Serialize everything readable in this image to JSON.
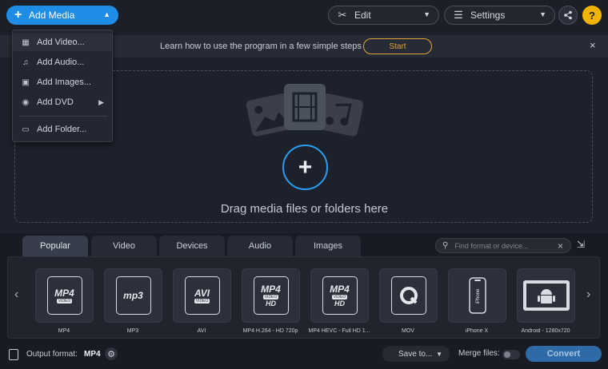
{
  "toolbar": {
    "add_media_label": "Add Media",
    "edit_label": "Edit",
    "settings_label": "Settings",
    "help_label": "?"
  },
  "tutorial": {
    "text": "Learn how to use the program in a few simple steps",
    "start_label": "Start",
    "close_label": "×"
  },
  "dropzone": {
    "text": "Drag media files or folders here"
  },
  "add_menu": {
    "items": [
      {
        "label": "Add Video...",
        "icon": "film-icon"
      },
      {
        "label": "Add Audio...",
        "icon": "music-note-icon"
      },
      {
        "label": "Add Images...",
        "icon": "image-icon"
      },
      {
        "label": "Add DVD",
        "icon": "disc-icon",
        "has_submenu": true
      },
      {
        "label": "Add Folder...",
        "icon": "folder-icon"
      }
    ]
  },
  "tabs": [
    "Popular",
    "Video",
    "Devices",
    "Audio",
    "Images"
  ],
  "active_tab": "Popular",
  "search": {
    "placeholder": "Find format or device...",
    "clear_label": "×"
  },
  "formats": [
    {
      "label": "MP4",
      "badge": "MP4",
      "sub": "VIDEO"
    },
    {
      "label": "MP3",
      "badge": "mp3",
      "sub": ""
    },
    {
      "label": "AVI",
      "badge": "AVI",
      "sub": "VIDEO"
    },
    {
      "label": "MP4 H.264 - HD 720p",
      "badge": "MP4",
      "sub": "VIDEO",
      "extra": "HD"
    },
    {
      "label": "MP4 HEVC - Full HD 1...",
      "badge": "MP4",
      "sub": "VIDEO",
      "extra": "HD"
    },
    {
      "label": "MOV",
      "badge": "Q",
      "sub": ""
    },
    {
      "label": "iPhone X",
      "badge": "iPhone",
      "sub": ""
    },
    {
      "label": "Android - 1280x720",
      "badge": "android",
      "sub": ""
    }
  ],
  "bottom": {
    "output_format_label": "Output format:",
    "output_format_value": "MP4",
    "save_to_label": "Save to...",
    "merge_label": "Merge files:",
    "convert_label": "Convert"
  },
  "colors": {
    "accent": "#1f8ce6",
    "start_border": "#e2a43a",
    "help_bg": "#f0b400",
    "convert_bg": "#2d6aa6"
  }
}
